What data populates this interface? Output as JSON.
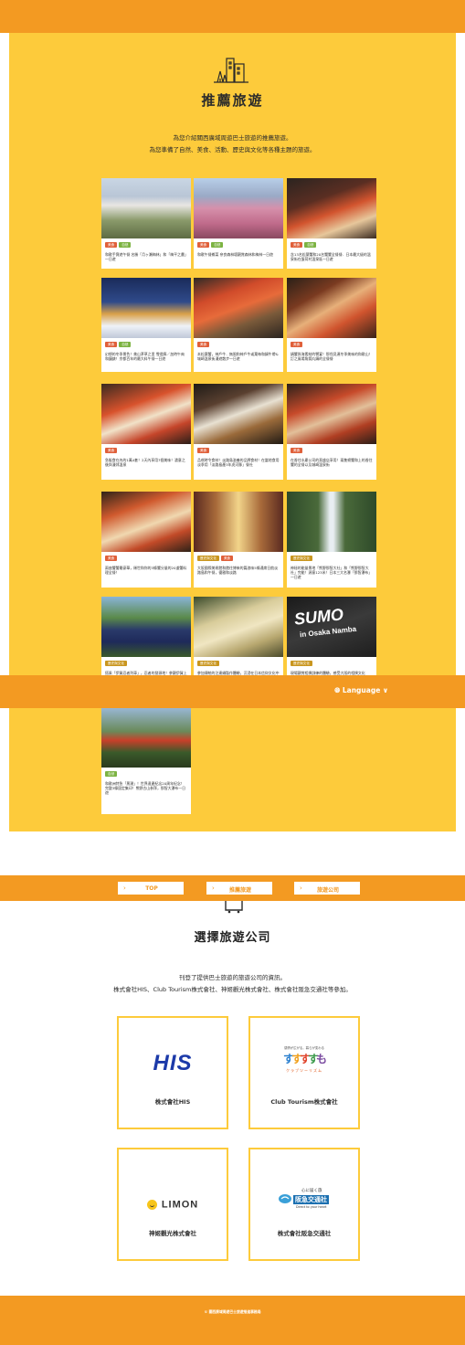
{
  "hero": {
    "icon": "city-buildings-icon",
    "title": "推薦旅遊",
    "intro_line1": "為您介紹關西廣域周遊巴士旅遊的推薦旅遊。",
    "intro_line2": "為您準備了自然、美食、活動、歷史與文化等各種主題的旅遊。"
  },
  "tag_colors": {
    "美食": "#e0603a",
    "自然": "#7cb342",
    "歷史與文化": "#c9961f"
  },
  "cards": [
    {
      "tags": [
        "美食",
        "自然"
      ],
      "text": "和歌手寶遊午餐 名勝「月ヶ瀬梅林」和「梅平之畫」一日遊",
      "photo": "plum-blossom-photo"
    },
    {
      "tags": [
        "美食",
        "自然"
      ],
      "text": "和歌午餐鄉菜 奈良森林壇觀賞森林和梅林一日遊",
      "photo": "pink-blossom-photo"
    },
    {
      "tags": [
        "美食",
        "自然"
      ],
      "text": "含13名松葉蟹和20名蟹蟹全餐餐．日本最大級的溫泉街在蛋荷村溫泉區一日遊",
      "photo": "crab-feast-photo"
    },
    {
      "tags": [
        "美食",
        "自然"
      ],
      "text": "幻想的冬季景色！美山茅草之里 雪燈廊／加時午肉和鐘錶！京都百年的最大料午餐一日遊",
      "photo": "snow-village-photo"
    },
    {
      "tags": [
        "美食"
      ],
      "text": "本松葉蟹，神戶牛．無限和神戶牛或葉每和鍋牛帶&城崎溫泉街漫遊散步一日遊",
      "photo": "crab-beef-photo"
    },
    {
      "tags": [
        "美食"
      ],
      "text": "鍋蟹與海素結的饗宴！那伐見連冬季美味的和歌山！訂之風場角錦丸鍋的全餐餐",
      "photo": "seafood-set-photo"
    },
    {
      "tags": [
        "美食"
      ],
      "text": "急販食在內的1萬4套！2天內享用7個美味！濃意之後與漫郊溫泉",
      "photo": "crab-platter-photo"
    },
    {
      "tags": [
        "美食"
      ],
      "text": "品嚐時令食材！淡路島滋養的品牌食材！在當地食用淡季用「淡路島產3年虎河豚」餐社",
      "photo": "pufferfish-set-photo"
    },
    {
      "tags": [
        "美食"
      ],
      "text": "在香住水產公司的直盛店享用！兩隻螃蟹和上的香住蟹的全餐以及城崎溫泉街",
      "photo": "kasumi-crab-photo"
    },
    {
      "tags": [
        "美食"
      ],
      "text": "兩座蟹蟹最豪華，稀世和你的3條蟹分量的20道蟹料理全餐！",
      "photo": "crab-dishes-photo"
    },
    {
      "tags": [
        "歷史與文化",
        "美食"
      ],
      "text": "大阪國際美術館和館往博來的篇浪味5條通席日航淡路島和午餐，優雅和淡路",
      "photo": "museum-hall-photo"
    },
    {
      "tags": [
        "歷史與文化"
      ],
      "text": "神秘的能量景地「熊野那智大社」和「熊野那智大社」完能！源意123米！日本三大名瀑「那智瀑布」一日遊",
      "photo": "nachi-waterfall-photo"
    },
    {
      "tags": [
        "歷史與文化"
      ],
      "text": "搭乘「伊賀忍者列車」，忍者的發源地！參觀伊賀上野城一日遊",
      "photo": "ninja-train-photo"
    },
    {
      "tags": [
        "歷史與文化"
      ],
      "text": "參加傳統的注連繩製作體驗，沉浸在日本信仰文化中",
      "photo": "shimenawa-rope-photo"
    },
    {
      "tags": [
        "歷史與文化"
      ],
      "text": "現場觀賞相撲訓練的體驗，感受大阪的相撲文化",
      "photo": "sumo-photo",
      "overlay": "SUMO",
      "overlay_sub": "in Osaka Namba"
    },
    {
      "tags": [
        "自然"
      ],
      "text": "和歌洲特急「黑潮」！世界遺產紀念20周年紀念！完整3條固定集印！熊野古山参拜，那智大瀑布一日遊",
      "photo": "pagoda-waterfall-photo"
    }
  ],
  "language_bar": {
    "icon": "globe-icon",
    "label": "Language",
    "chevron": "chevron-down-icon"
  },
  "nav": [
    {
      "label": "TOP"
    },
    {
      "label": "推薦旅遊"
    },
    {
      "label": "旅遊公司"
    }
  ],
  "companies_section": {
    "icon": "bus-icon",
    "title": "選擇旅遊公司",
    "intro_line1": "刊登了提供巴士旅遊的旅遊公司的資訊。",
    "intro_line2": "株式會社HIS、Club Tourism株式會社、神姬觀光株式會社、株式會社阪急交通社等參加。",
    "companies": [
      {
        "name": "株式會社HIS",
        "logo_text": "HIS",
        "logo_color": "#1c3aa9"
      },
      {
        "name": "Club Tourism株式會社",
        "logo_text": "クラブツーリズム",
        "logo_tagline": "感情が広がる。暮らが変わる",
        "logo_color": "#e05a1e"
      },
      {
        "name": "神姬觀光株式會社",
        "logo_text": "LIMON",
        "logo_color": "#333333"
      },
      {
        "name": "株式會社阪急交通社",
        "logo_text": "阪急交通社",
        "logo_tagline": "心に届く旅",
        "logo_sub": "Direct to your heart",
        "logo_color": "#1a6fb0"
      }
    ]
  },
  "footer": {
    "copyright": "© 關西廣域周遊巴士旅遊推進事務局"
  },
  "colors": {
    "orange": "#f39a22",
    "yellow": "#fdcb3b"
  }
}
